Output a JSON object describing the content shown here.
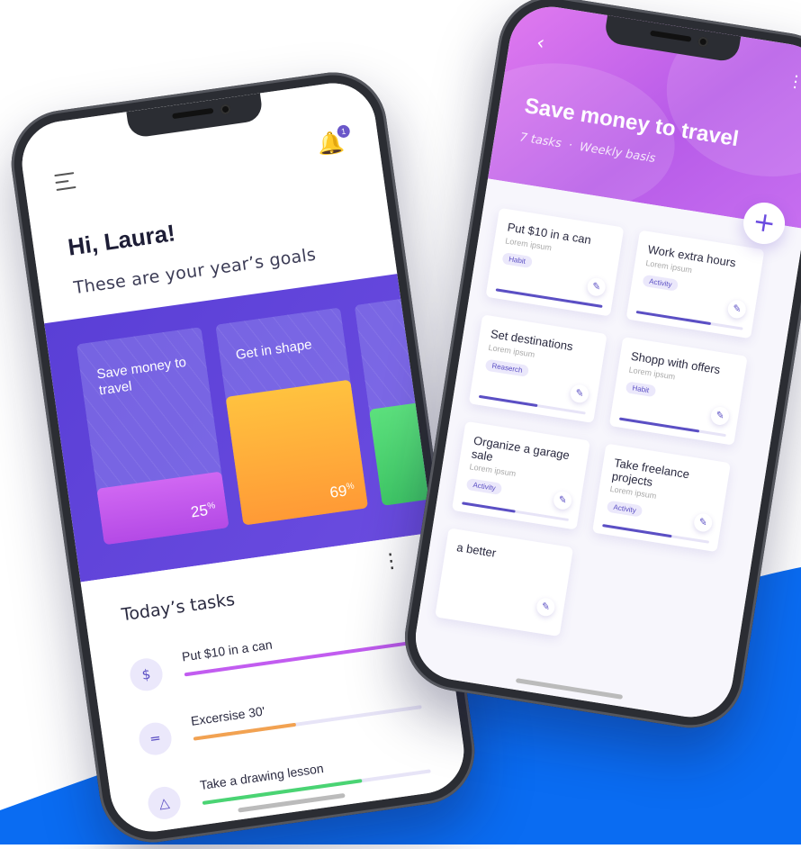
{
  "colors": {
    "accent": "#5b4fc4",
    "header_purple": "#b75be8",
    "background_blue": "#0a6cf2",
    "goal_purple": "#c25cf0",
    "goal_orange": "#ffae3a",
    "goal_green": "#4ad473"
  },
  "home": {
    "notification_count": "1",
    "greeting": "Hi, Laura!",
    "goals_subtitle": "These are your year’s goals",
    "goals": [
      {
        "title": "Save money to travel",
        "percent_value": "25",
        "percent_sign": "%",
        "progress": 0.25
      },
      {
        "title": "Get in shape",
        "percent_value": "69",
        "percent_sign": "%",
        "progress": 0.69
      },
      {
        "title": "",
        "percent_value": "",
        "percent_sign": "",
        "progress": 0.5
      }
    ],
    "tasks_title": "Today’s tasks",
    "tasks": [
      {
        "icon": "dollar-icon",
        "glyph": "$",
        "name": "Put $10 in a can",
        "progress": 1.0,
        "color": "#c25cf0"
      },
      {
        "icon": "dumbbell-icon",
        "glyph": "═",
        "name": "Excersise 30'",
        "progress": 0.45,
        "color": "#f2a251"
      },
      {
        "icon": "graduation-cap-icon",
        "glyph": "△",
        "name": "Take a drawing lesson",
        "progress": 0.7,
        "color": "#4ad473"
      }
    ]
  },
  "detail": {
    "back_icon": "chevron-left-icon",
    "title": "Save money to travel",
    "tasks_count": "7 tasks",
    "separator": "·",
    "frequency": "Weekly basis",
    "add_label": "+",
    "cards": [
      {
        "title": "Put $10 in a can",
        "desc": "Lorem ipsum",
        "tag": "Habit",
        "progress": 1.0
      },
      {
        "title": "Work extra hours",
        "desc": "Lorem ipsum",
        "tag": "Activity",
        "progress": 0.7
      },
      {
        "title": "Set destinations",
        "desc": "Lorem ipsum",
        "tag": "Reaserch",
        "progress": 0.55
      },
      {
        "title": "Shopp with offers",
        "desc": "Lorem ipsum",
        "tag": "Habit",
        "progress": 0.75
      },
      {
        "title": "Organize a garage sale",
        "desc": "Lorem ipsum",
        "tag": "Activity",
        "progress": 0.5
      },
      {
        "title": "Take freelance projects",
        "desc": "Lorem ipsum",
        "tag": "Activity",
        "progress": 0.65
      },
      {
        "title": "a better",
        "desc": "",
        "tag": "",
        "progress": 0.0
      }
    ]
  }
}
